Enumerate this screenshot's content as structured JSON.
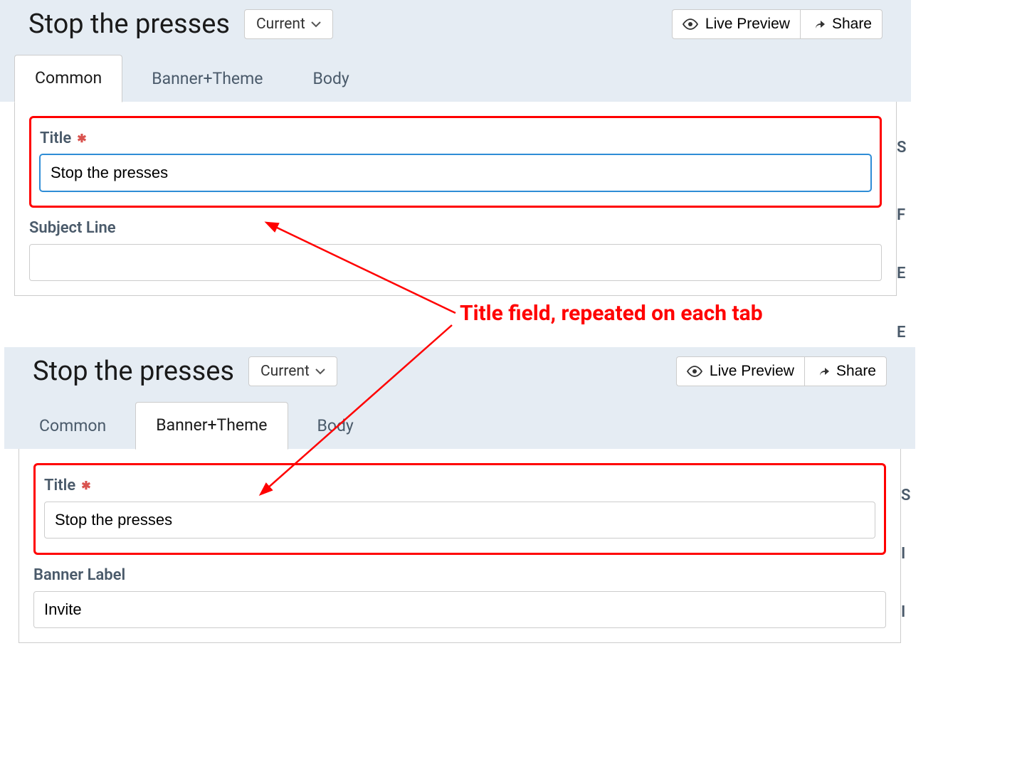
{
  "header": {
    "title": "Stop the presses",
    "version_label": "Current",
    "preview_label": "Live Preview",
    "share_label": "Share"
  },
  "tabs": [
    "Common",
    "Banner+Theme",
    "Body"
  ],
  "panel1": {
    "active_tab_index": 0,
    "title_label": "Title",
    "title_value": "Stop the presses",
    "subject_label": "Subject Line",
    "subject_value": ""
  },
  "panel2": {
    "active_tab_index": 1,
    "title_label": "Title",
    "title_value": "Stop the presses",
    "banner_label": "Banner Label",
    "banner_value": "Invite"
  },
  "callout": "Title field, repeated on each tab",
  "icons": {
    "chevron_down": "chevron-down",
    "eye": "eye",
    "share": "share"
  },
  "colors": {
    "header_bg": "#e5ecf3",
    "tab_inactive_text": "#4a5a6a",
    "highlight": "#ff0000",
    "input_focus": "#2e8dd6"
  }
}
